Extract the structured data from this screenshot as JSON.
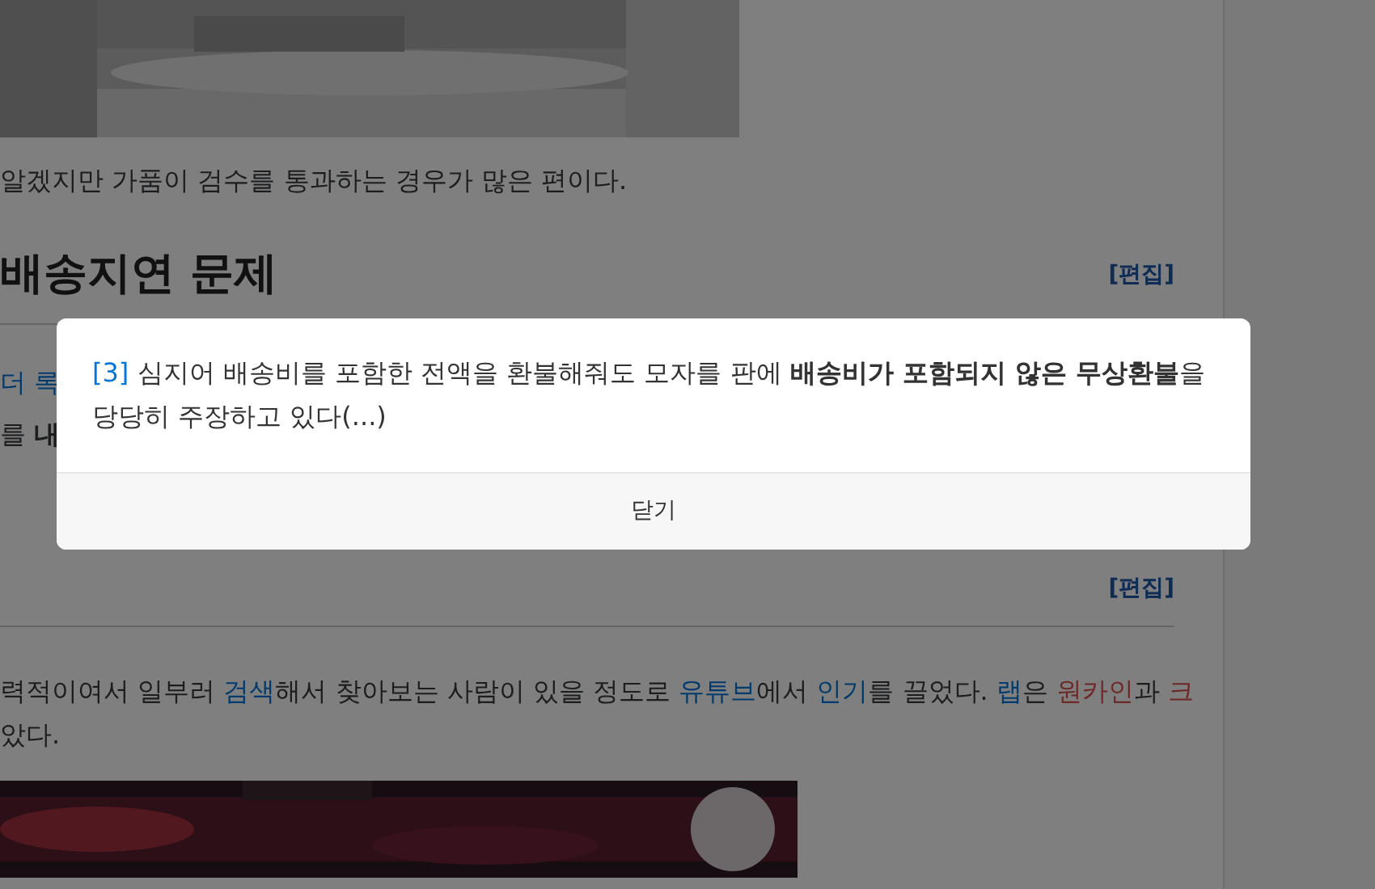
{
  "article": {
    "caption_line": "알겠지만 가품이 검수를 통과하는 경우가 많은 편이다.",
    "section_1": {
      "title": "배송지연 문제",
      "edit_link": "[편집]"
    },
    "hidden_lines": [
      {
        "kind": "link",
        "text": "더 록"
      },
      {
        "kind": "text",
        "text": "를 **내**"
      }
    ],
    "section_2": {
      "edit_link": "[편집]"
    },
    "paragraph": [
      {
        "kind": "text",
        "text": "력적이여서 일부러 "
      },
      {
        "kind": "link",
        "text": "검색"
      },
      {
        "kind": "text",
        "text": "해서 찾아보는 사람이 있을 정도로 "
      },
      {
        "kind": "link",
        "text": "유튜브"
      },
      {
        "kind": "text",
        "text": "에서 "
      },
      {
        "kind": "link",
        "text": "인기"
      },
      {
        "kind": "text",
        "text": "를 끌었다. "
      },
      {
        "kind": "link",
        "text": "랩"
      },
      {
        "kind": "text",
        "text": "은 "
      },
      {
        "kind": "redlink",
        "text": "원카인"
      },
      {
        "kind": "text",
        "text": "과 "
      },
      {
        "kind": "redlink",
        "text": "크"
      }
    ],
    "paragraph_end": "았다."
  },
  "footnote_popup": {
    "ref": "[3]",
    "text": "심지어 배송비를 포함한 전액을 환불해줘도 모자를 판에 **배송비가 포함되지 않은 무상환불**을 당당히 주장하고 있다(...)",
    "close_button": "닫기"
  }
}
